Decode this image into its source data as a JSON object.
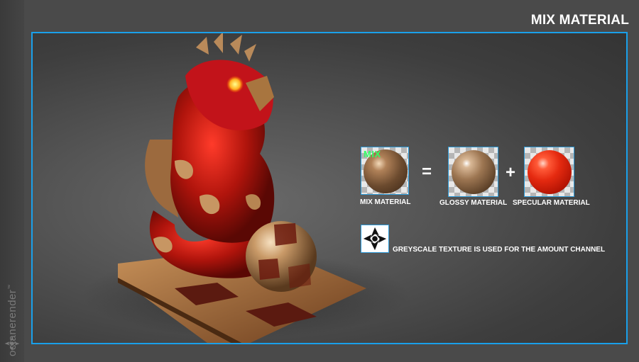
{
  "header": {
    "title": "MIX MATERIAL"
  },
  "brand": {
    "name": "octanerender",
    "trademark": "™",
    "logo_icon": "octane-logo-icon"
  },
  "colors": {
    "frame_accent": "#1aa0ea",
    "mix_label": "#33ff66",
    "background": "#4a4a4a"
  },
  "equation": {
    "mix": {
      "tag": "MIX",
      "label": "MIX MATERIAL"
    },
    "equals": "=",
    "glossy": {
      "label": "GLOSSY MATERIAL"
    },
    "plus": "+",
    "specular": {
      "label": "SPECULAR MATERIAL"
    }
  },
  "texture_note": {
    "icon": "greyscale-texture-icon",
    "text": "GREYSCALE TEXTURE IS USED FOR THE AMOUNT CHANNEL"
  }
}
